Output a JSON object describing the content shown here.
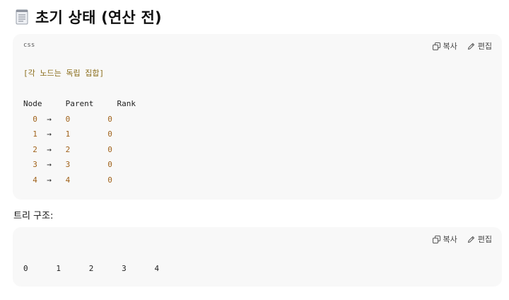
{
  "heading": {
    "icon": "memo-icon",
    "title": "초기 상태 (연산 전)"
  },
  "block_1": {
    "language": "css",
    "actions": {
      "copy_label": "복사",
      "edit_label": "편집"
    },
    "comment": "[각 노드는 독립 집합]",
    "table": {
      "headers": [
        "Node",
        "Parent",
        "Rank"
      ],
      "arrow": "→",
      "rows": [
        {
          "node": "0",
          "parent": "0",
          "rank": "0"
        },
        {
          "node": "1",
          "parent": "1",
          "rank": "0"
        },
        {
          "node": "2",
          "parent": "2",
          "rank": "0"
        },
        {
          "node": "3",
          "parent": "3",
          "rank": "0"
        },
        {
          "node": "4",
          "parent": "4",
          "rank": "0"
        }
      ]
    }
  },
  "section_label": "트리 구조:",
  "block_2": {
    "actions": {
      "copy_label": "복사",
      "edit_label": "편집"
    },
    "nodes": [
      "0",
      "1",
      "2",
      "3",
      "4"
    ]
  },
  "colors": {
    "block_background": "#f8f8f8",
    "comment": "#8a6d1b",
    "number": "#a0621a"
  }
}
